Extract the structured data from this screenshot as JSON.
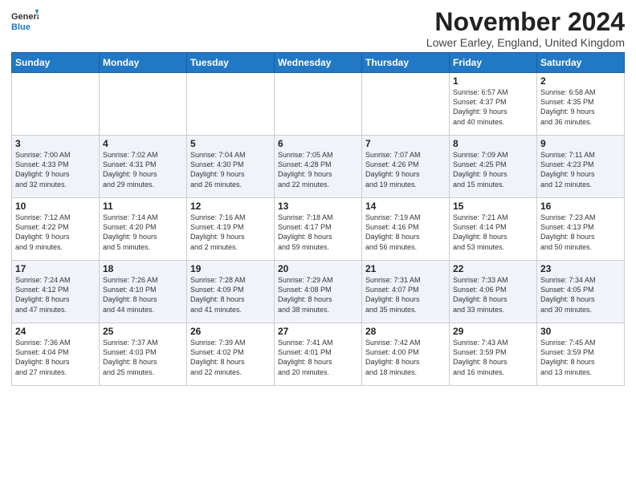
{
  "logo": {
    "general": "General",
    "blue": "Blue"
  },
  "title": "November 2024",
  "location": "Lower Earley, England, United Kingdom",
  "days_of_week": [
    "Sunday",
    "Monday",
    "Tuesday",
    "Wednesday",
    "Thursday",
    "Friday",
    "Saturday"
  ],
  "weeks": [
    [
      {
        "day": "",
        "info": ""
      },
      {
        "day": "",
        "info": ""
      },
      {
        "day": "",
        "info": ""
      },
      {
        "day": "",
        "info": ""
      },
      {
        "day": "",
        "info": ""
      },
      {
        "day": "1",
        "info": "Sunrise: 6:57 AM\nSunset: 4:37 PM\nDaylight: 9 hours\nand 40 minutes."
      },
      {
        "day": "2",
        "info": "Sunrise: 6:58 AM\nSunset: 4:35 PM\nDaylight: 9 hours\nand 36 minutes."
      }
    ],
    [
      {
        "day": "3",
        "info": "Sunrise: 7:00 AM\nSunset: 4:33 PM\nDaylight: 9 hours\nand 32 minutes."
      },
      {
        "day": "4",
        "info": "Sunrise: 7:02 AM\nSunset: 4:31 PM\nDaylight: 9 hours\nand 29 minutes."
      },
      {
        "day": "5",
        "info": "Sunrise: 7:04 AM\nSunset: 4:30 PM\nDaylight: 9 hours\nand 26 minutes."
      },
      {
        "day": "6",
        "info": "Sunrise: 7:05 AM\nSunset: 4:28 PM\nDaylight: 9 hours\nand 22 minutes."
      },
      {
        "day": "7",
        "info": "Sunrise: 7:07 AM\nSunset: 4:26 PM\nDaylight: 9 hours\nand 19 minutes."
      },
      {
        "day": "8",
        "info": "Sunrise: 7:09 AM\nSunset: 4:25 PM\nDaylight: 9 hours\nand 15 minutes."
      },
      {
        "day": "9",
        "info": "Sunrise: 7:11 AM\nSunset: 4:23 PM\nDaylight: 9 hours\nand 12 minutes."
      }
    ],
    [
      {
        "day": "10",
        "info": "Sunrise: 7:12 AM\nSunset: 4:22 PM\nDaylight: 9 hours\nand 9 minutes."
      },
      {
        "day": "11",
        "info": "Sunrise: 7:14 AM\nSunset: 4:20 PM\nDaylight: 9 hours\nand 5 minutes."
      },
      {
        "day": "12",
        "info": "Sunrise: 7:16 AM\nSunset: 4:19 PM\nDaylight: 9 hours\nand 2 minutes."
      },
      {
        "day": "13",
        "info": "Sunrise: 7:18 AM\nSunset: 4:17 PM\nDaylight: 8 hours\nand 59 minutes."
      },
      {
        "day": "14",
        "info": "Sunrise: 7:19 AM\nSunset: 4:16 PM\nDaylight: 8 hours\nand 56 minutes."
      },
      {
        "day": "15",
        "info": "Sunrise: 7:21 AM\nSunset: 4:14 PM\nDaylight: 8 hours\nand 53 minutes."
      },
      {
        "day": "16",
        "info": "Sunrise: 7:23 AM\nSunset: 4:13 PM\nDaylight: 8 hours\nand 50 minutes."
      }
    ],
    [
      {
        "day": "17",
        "info": "Sunrise: 7:24 AM\nSunset: 4:12 PM\nDaylight: 8 hours\nand 47 minutes."
      },
      {
        "day": "18",
        "info": "Sunrise: 7:26 AM\nSunset: 4:10 PM\nDaylight: 8 hours\nand 44 minutes."
      },
      {
        "day": "19",
        "info": "Sunrise: 7:28 AM\nSunset: 4:09 PM\nDaylight: 8 hours\nand 41 minutes."
      },
      {
        "day": "20",
        "info": "Sunrise: 7:29 AM\nSunset: 4:08 PM\nDaylight: 8 hours\nand 38 minutes."
      },
      {
        "day": "21",
        "info": "Sunrise: 7:31 AM\nSunset: 4:07 PM\nDaylight: 8 hours\nand 35 minutes."
      },
      {
        "day": "22",
        "info": "Sunrise: 7:33 AM\nSunset: 4:06 PM\nDaylight: 8 hours\nand 33 minutes."
      },
      {
        "day": "23",
        "info": "Sunrise: 7:34 AM\nSunset: 4:05 PM\nDaylight: 8 hours\nand 30 minutes."
      }
    ],
    [
      {
        "day": "24",
        "info": "Sunrise: 7:36 AM\nSunset: 4:04 PM\nDaylight: 8 hours\nand 27 minutes."
      },
      {
        "day": "25",
        "info": "Sunrise: 7:37 AM\nSunset: 4:03 PM\nDaylight: 8 hours\nand 25 minutes."
      },
      {
        "day": "26",
        "info": "Sunrise: 7:39 AM\nSunset: 4:02 PM\nDaylight: 8 hours\nand 22 minutes."
      },
      {
        "day": "27",
        "info": "Sunrise: 7:41 AM\nSunset: 4:01 PM\nDaylight: 8 hours\nand 20 minutes."
      },
      {
        "day": "28",
        "info": "Sunrise: 7:42 AM\nSunset: 4:00 PM\nDaylight: 8 hours\nand 18 minutes."
      },
      {
        "day": "29",
        "info": "Sunrise: 7:43 AM\nSunset: 3:59 PM\nDaylight: 8 hours\nand 16 minutes."
      },
      {
        "day": "30",
        "info": "Sunrise: 7:45 AM\nSunset: 3:59 PM\nDaylight: 8 hours\nand 13 minutes."
      }
    ]
  ]
}
